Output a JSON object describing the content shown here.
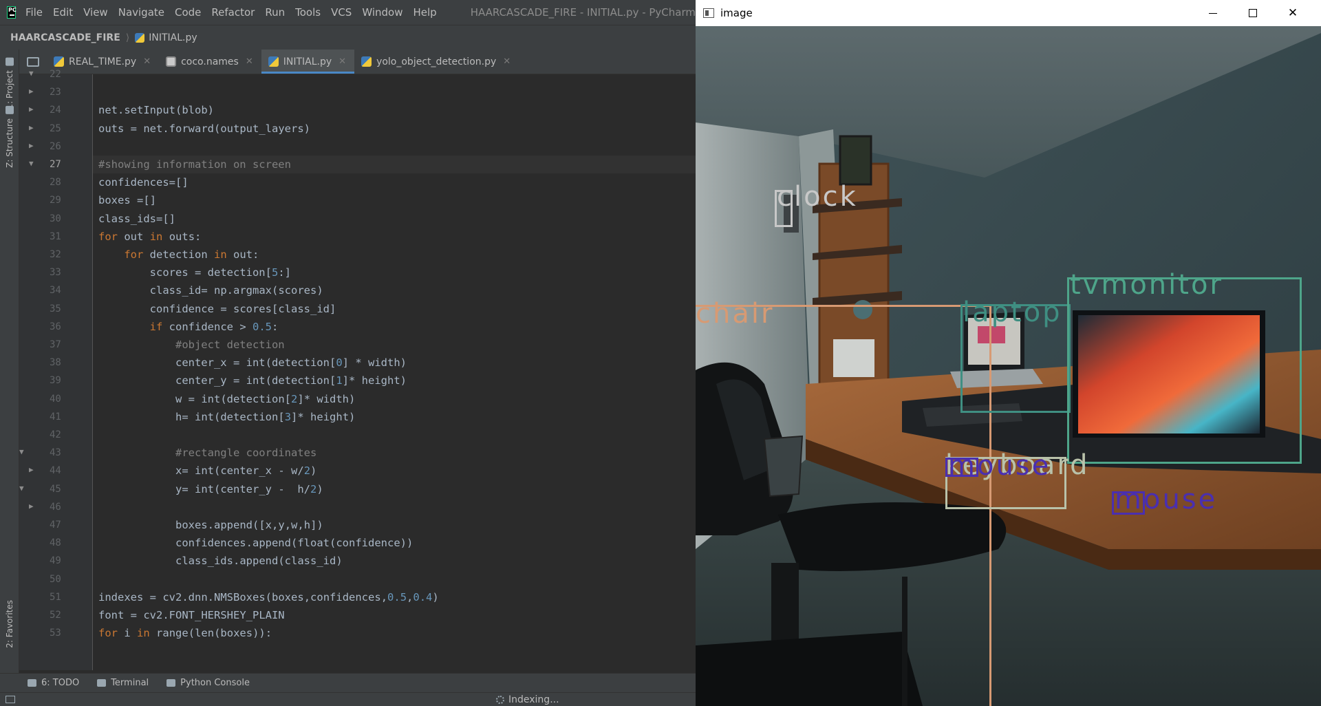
{
  "ide": {
    "menu": [
      "File",
      "Edit",
      "View",
      "Navigate",
      "Code",
      "Refactor",
      "Run",
      "Tools",
      "VCS",
      "Window",
      "Help"
    ],
    "window_title": "HAARCASCADE_FIRE - INITIAL.py - PyCharm",
    "breadcrumb": {
      "project": "HAARCASCADE_FIRE",
      "file": "INITIAL.py"
    },
    "tabs": [
      {
        "label": "REAL_TIME.py",
        "icon": "python-file-icon"
      },
      {
        "label": "coco.names",
        "icon": "text-file-icon"
      },
      {
        "label": "INITIAL.py",
        "icon": "python-file-icon",
        "active": true
      },
      {
        "label": "yolo_object_detection.py",
        "icon": "python-file-icon"
      }
    ],
    "side_tabs": {
      "project": "1: Project",
      "structure": "Z: Structure",
      "favorites": "2: Favorites"
    },
    "current_line": 27,
    "code_lines": [
      {
        "num": "22",
        "text": ""
      },
      {
        "num": "23",
        "text": ""
      },
      {
        "num": "24",
        "text": "net.setInput(blob)"
      },
      {
        "num": "25",
        "text": "outs = net.forward(output_layers)"
      },
      {
        "num": "26",
        "text": ""
      },
      {
        "num": "27",
        "text": "#showing information on screen"
      },
      {
        "num": "28",
        "text": "confidences=[]"
      },
      {
        "num": "29",
        "text": "boxes =[]"
      },
      {
        "num": "30",
        "text": "class_ids=[]"
      },
      {
        "num": "31",
        "text": "for out in outs:"
      },
      {
        "num": "32",
        "text": "    for detection in out:"
      },
      {
        "num": "33",
        "text": "        scores = detection[5:]"
      },
      {
        "num": "34",
        "text": "        class_id= np.argmax(scores)"
      },
      {
        "num": "35",
        "text": "        confidence = scores[class_id]"
      },
      {
        "num": "36",
        "text": "        if confidence > 0.5:"
      },
      {
        "num": "37",
        "text": "            #object detection"
      },
      {
        "num": "38",
        "text": "            center_x = int(detection[0] * width)"
      },
      {
        "num": "39",
        "text": "            center_y = int(detection[1]* height)"
      },
      {
        "num": "40",
        "text": "            w = int(detection[2]* width)"
      },
      {
        "num": "41",
        "text": "            h= int(detection[3]* height)"
      },
      {
        "num": "42",
        "text": ""
      },
      {
        "num": "43",
        "text": "            #rectangle coordinates"
      },
      {
        "num": "44",
        "text": "            x= int(center_x - w/2)"
      },
      {
        "num": "45",
        "text": "            y= int(center_y -  h/2)"
      },
      {
        "num": "46",
        "text": ""
      },
      {
        "num": "47",
        "text": "            boxes.append([x,y,w,h])"
      },
      {
        "num": "48",
        "text": "            confidences.append(float(confidence))"
      },
      {
        "num": "49",
        "text": "            class_ids.append(class_id)"
      },
      {
        "num": "50",
        "text": ""
      },
      {
        "num": "51",
        "text": "indexes = cv2.dnn.NMSBoxes(boxes,confidences,0.5,0.4)"
      },
      {
        "num": "52",
        "text": "font = cv2.FONT_HERSHEY_PLAIN"
      },
      {
        "num": "53",
        "text": "for i in range(len(boxes)):"
      }
    ],
    "tool_windows": [
      {
        "label": "6: TODO",
        "icon": "todo-list-icon"
      },
      {
        "label": "Terminal",
        "icon": "terminal-icon"
      },
      {
        "label": "Python Console",
        "icon": "python-console-icon"
      }
    ],
    "status": "Indexing...",
    "colors": {
      "keyword": "#cc7832",
      "number": "#6897bb",
      "comment": "#808080",
      "text": "#a9b7c6",
      "accent": "#4a88c7"
    }
  },
  "image_window": {
    "title": "image",
    "controls": [
      "minimize",
      "maximize",
      "close"
    ],
    "detections": [
      {
        "label": "clock",
        "color": "#c8c8c8"
      },
      {
        "label": "chair",
        "color": "#d79a73"
      },
      {
        "label": "laptop",
        "color": "#3f8f82"
      },
      {
        "label": "tvmonitor",
        "color": "#4ea58a"
      },
      {
        "label": "mouse",
        "color": "#4a2fb0"
      },
      {
        "label": "keyboard",
        "color": "#b9c2aa"
      },
      {
        "label": "mouse",
        "color": "#4a2fb0"
      }
    ]
  }
}
